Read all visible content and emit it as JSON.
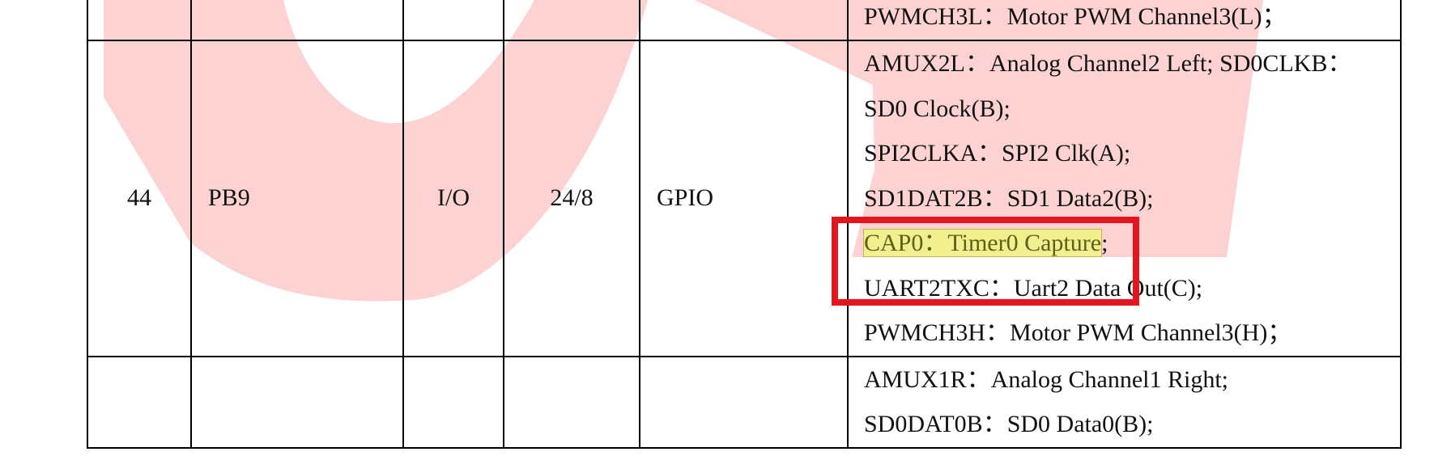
{
  "colors": {
    "watermark": "#fdd2d2",
    "callout_border": "#e3161f",
    "highlight": "#f2ef8f"
  },
  "table": {
    "rows": [
      {
        "number": "",
        "pin": "",
        "type": "",
        "drive": "",
        "default": "",
        "functions": [
          "PWMCH3L：Motor PWM Channel3(L)；"
        ]
      },
      {
        "number": "44",
        "pin": "PB9",
        "type": "I/O",
        "drive": "24/8",
        "default": "GPIO",
        "functions": [
          "AMUX2L：Analog Channel2 Left; SD0CLKB：",
          "SD0 Clock(B);",
          "SPI2CLKA：SPI2 Clk(A);",
          "SD1DAT2B：SD1 Data2(B);",
          "CAP0：Timer0 Capture",
          "UART2TXC：Uart2 Data Out(C);",
          "PWMCH3H：Motor PWM Channel3(H)；"
        ],
        "highlight_suffix": ";"
      },
      {
        "number": "",
        "pin": "",
        "type": "",
        "drive": "",
        "default": "",
        "functions": [
          "AMUX1R：Analog Channel1 Right;",
          "SD0DAT0B：SD0 Data0(B);"
        ]
      }
    ]
  }
}
